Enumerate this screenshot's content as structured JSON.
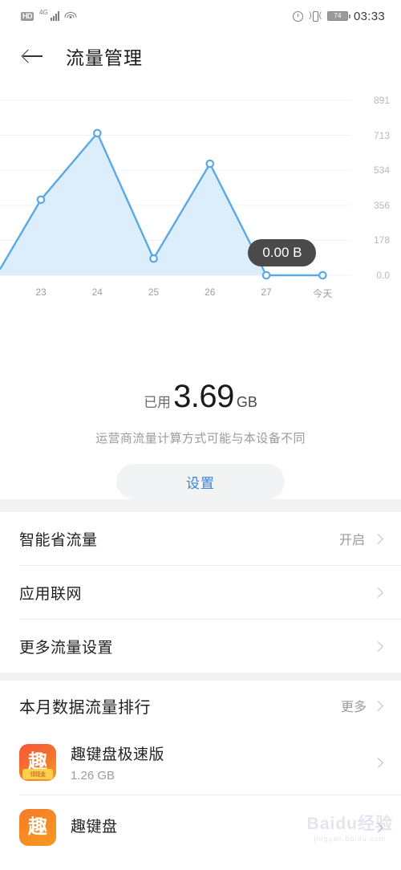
{
  "statusbar": {
    "hd": "HD",
    "network": "4G",
    "battery_level": "74",
    "time": "03:33",
    "icons": [
      "hd-icon",
      "signal-bars-icon",
      "wifi-icon",
      "alarm-icon",
      "vibrate-icon",
      "battery-icon"
    ]
  },
  "header": {
    "title": "流量管理",
    "back_icon": "back-arrow-icon"
  },
  "chart_data": {
    "type": "area",
    "title": "",
    "xlabel": "",
    "ylabel": "",
    "categories": [
      "23",
      "24",
      "25",
      "26",
      "27",
      "今天"
    ],
    "values": [
      385,
      724,
      85,
      568,
      0,
      0
    ],
    "y_ticks": [
      "891",
      "713",
      "534",
      "356",
      "178",
      "0.0"
    ],
    "ylim": [
      0,
      891
    ],
    "grid": true,
    "legend": "none",
    "line_color": "#5aa9e6",
    "fill_color": "#dceefb",
    "annotation": {
      "text": "0.00 B",
      "at_category": "今天"
    }
  },
  "usage": {
    "prefix": "已用",
    "value": "3.69",
    "unit": "GB",
    "note": "运营商流量计算方式可能与本设备不同",
    "settings_button": "设置"
  },
  "settings_rows": [
    {
      "label": "智能省流量",
      "value": "开启"
    },
    {
      "label": "应用联网",
      "value": ""
    },
    {
      "label": "更多流量设置",
      "value": ""
    }
  ],
  "ranking": {
    "title": "本月数据流量排行",
    "more": "更多",
    "apps": [
      {
        "name": "趣键盘极速版",
        "size": "1.26 GB",
        "icon_glyph": "趣",
        "icon_ribbon": "领现金"
      },
      {
        "name": "趣键盘",
        "size": "",
        "icon_glyph": "趣",
        "icon_ribbon": ""
      }
    ]
  },
  "watermark": {
    "main": "Baidu经验",
    "sub": "jingyan.baidu.com"
  }
}
